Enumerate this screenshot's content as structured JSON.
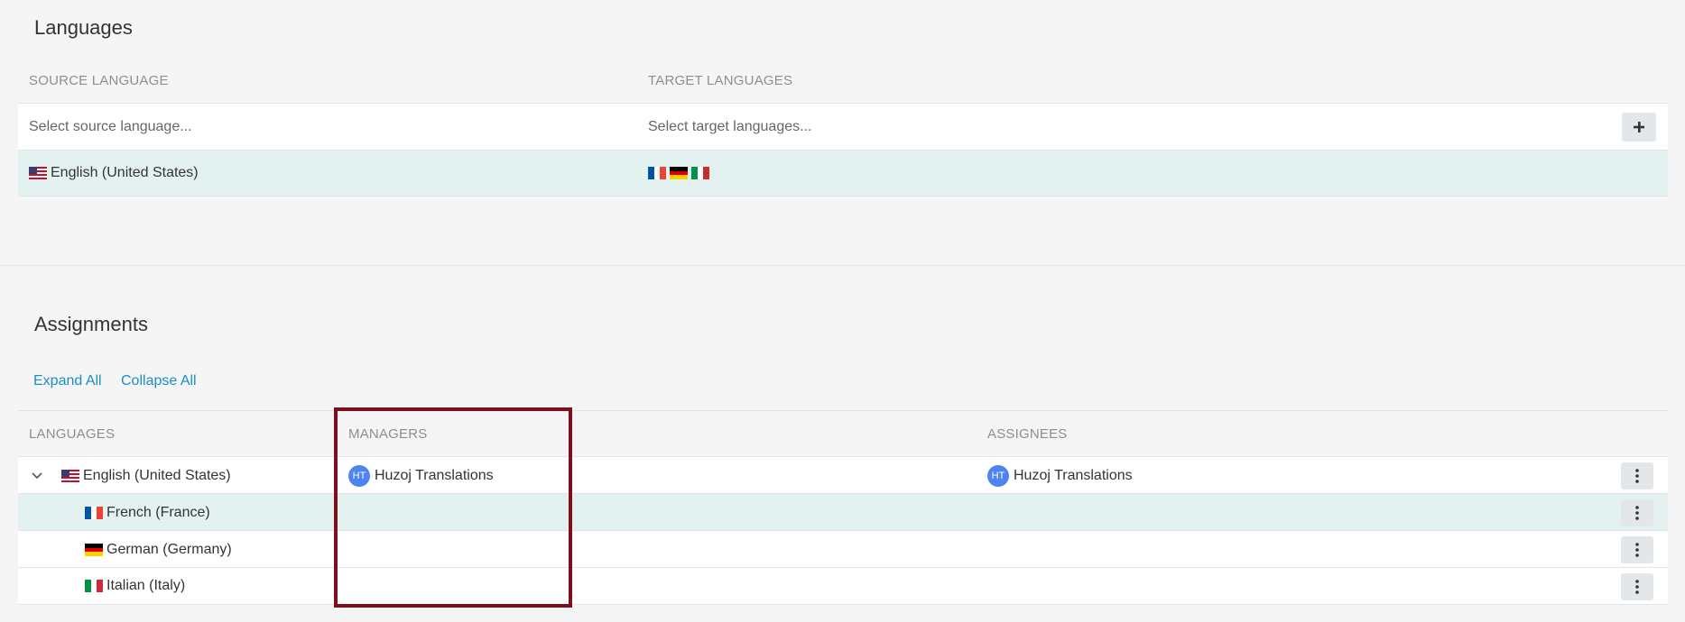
{
  "languages_section": {
    "title": "Languages",
    "headers": {
      "source": "SOURCE LANGUAGE",
      "target": "TARGET LANGUAGES"
    },
    "source_placeholder": "Select source language...",
    "target_placeholder": "Select target languages...",
    "add_button_icon": "plus-icon",
    "row": {
      "source_language": "English (United States)",
      "target_flags": [
        "flag-fr-icon",
        "flag-de-icon",
        "flag-it-icon"
      ]
    }
  },
  "assignments_section": {
    "title": "Assignments",
    "expand_all": "Expand All",
    "collapse_all": "Collapse All",
    "headers": {
      "languages": "LANGUAGES",
      "managers": "MANAGERS",
      "assignees": "ASSIGNEES"
    },
    "rows": [
      {
        "language": "English (United States)",
        "manager_initials": "HT",
        "manager": "Huzoj Translations",
        "assignee_initials": "HT",
        "assignee": "Huzoj Translations"
      },
      {
        "language": "French (France)"
      },
      {
        "language": "German (Germany)"
      },
      {
        "language": "Italian (Italy)"
      }
    ]
  },
  "colors": {
    "accent_link": "#1a8fc6",
    "highlight_row": "#e4f1f1",
    "avatar": "#4e84f0",
    "annotation_box": "#7d0f1f"
  }
}
